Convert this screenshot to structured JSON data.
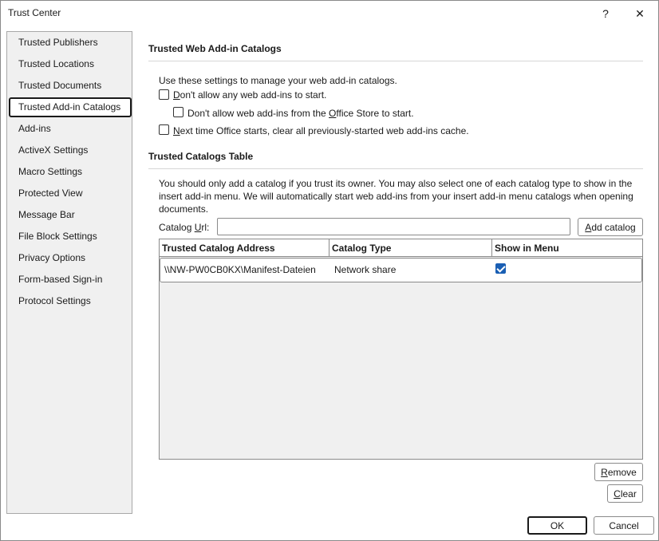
{
  "window": {
    "title": "Trust Center",
    "help_label": "?",
    "close_label": "✕"
  },
  "sidebar": {
    "items": [
      {
        "label": "Trusted Publishers"
      },
      {
        "label": "Trusted Locations"
      },
      {
        "label": "Trusted Documents"
      },
      {
        "label": "Trusted Add-in Catalogs",
        "selected": true
      },
      {
        "label": "Add-ins"
      },
      {
        "label": "ActiveX Settings"
      },
      {
        "label": "Macro Settings"
      },
      {
        "label": "Protected View"
      },
      {
        "label": "Message Bar"
      },
      {
        "label": "File Block Settings"
      },
      {
        "label": "Privacy Options"
      },
      {
        "label": "Form-based Sign-in"
      },
      {
        "label": "Protocol Settings"
      }
    ]
  },
  "web_catalogs": {
    "title": "Trusted Web Add-in Catalogs",
    "intro": "Use these settings to manage your web add-in catalogs.",
    "opt_dont_allow": {
      "accel": "D",
      "rest": "on't allow any web add-ins to start.",
      "checked": false
    },
    "opt_office_store": {
      "pre": "Don't allow web add-ins from the ",
      "accel": "O",
      "rest": "ffice Store to start.",
      "checked": false
    },
    "opt_clear_cache": {
      "accel": "N",
      "rest": "ext time Office starts, clear all previously-started web add-ins cache.",
      "checked": false
    }
  },
  "catalogs_table": {
    "title": "Trusted Catalogs Table",
    "description": "You should only add a catalog if you trust its owner. You may also select one of each catalog type to show in the insert add-in menu. We will automatically start web add-ins from your insert add-in menu catalogs when opening documents.",
    "url_label_pre": "Catalog ",
    "url_label_accel": "U",
    "url_label_rest": "rl:",
    "url_value": "",
    "add_button_accel": "A",
    "add_button_rest": "dd catalog",
    "columns": [
      "Trusted Catalog Address",
      "Catalog Type",
      "Show in Menu"
    ],
    "rows": [
      {
        "address": "\\\\NW-PW0CB0KX\\Manifest-Dateien",
        "type": "Network share",
        "show_in_menu": true
      }
    ],
    "remove_accel": "R",
    "remove_rest": "emove",
    "clear_accel": "C",
    "clear_rest": "lear"
  },
  "footer": {
    "ok_label": "OK",
    "cancel_label": "Cancel"
  }
}
